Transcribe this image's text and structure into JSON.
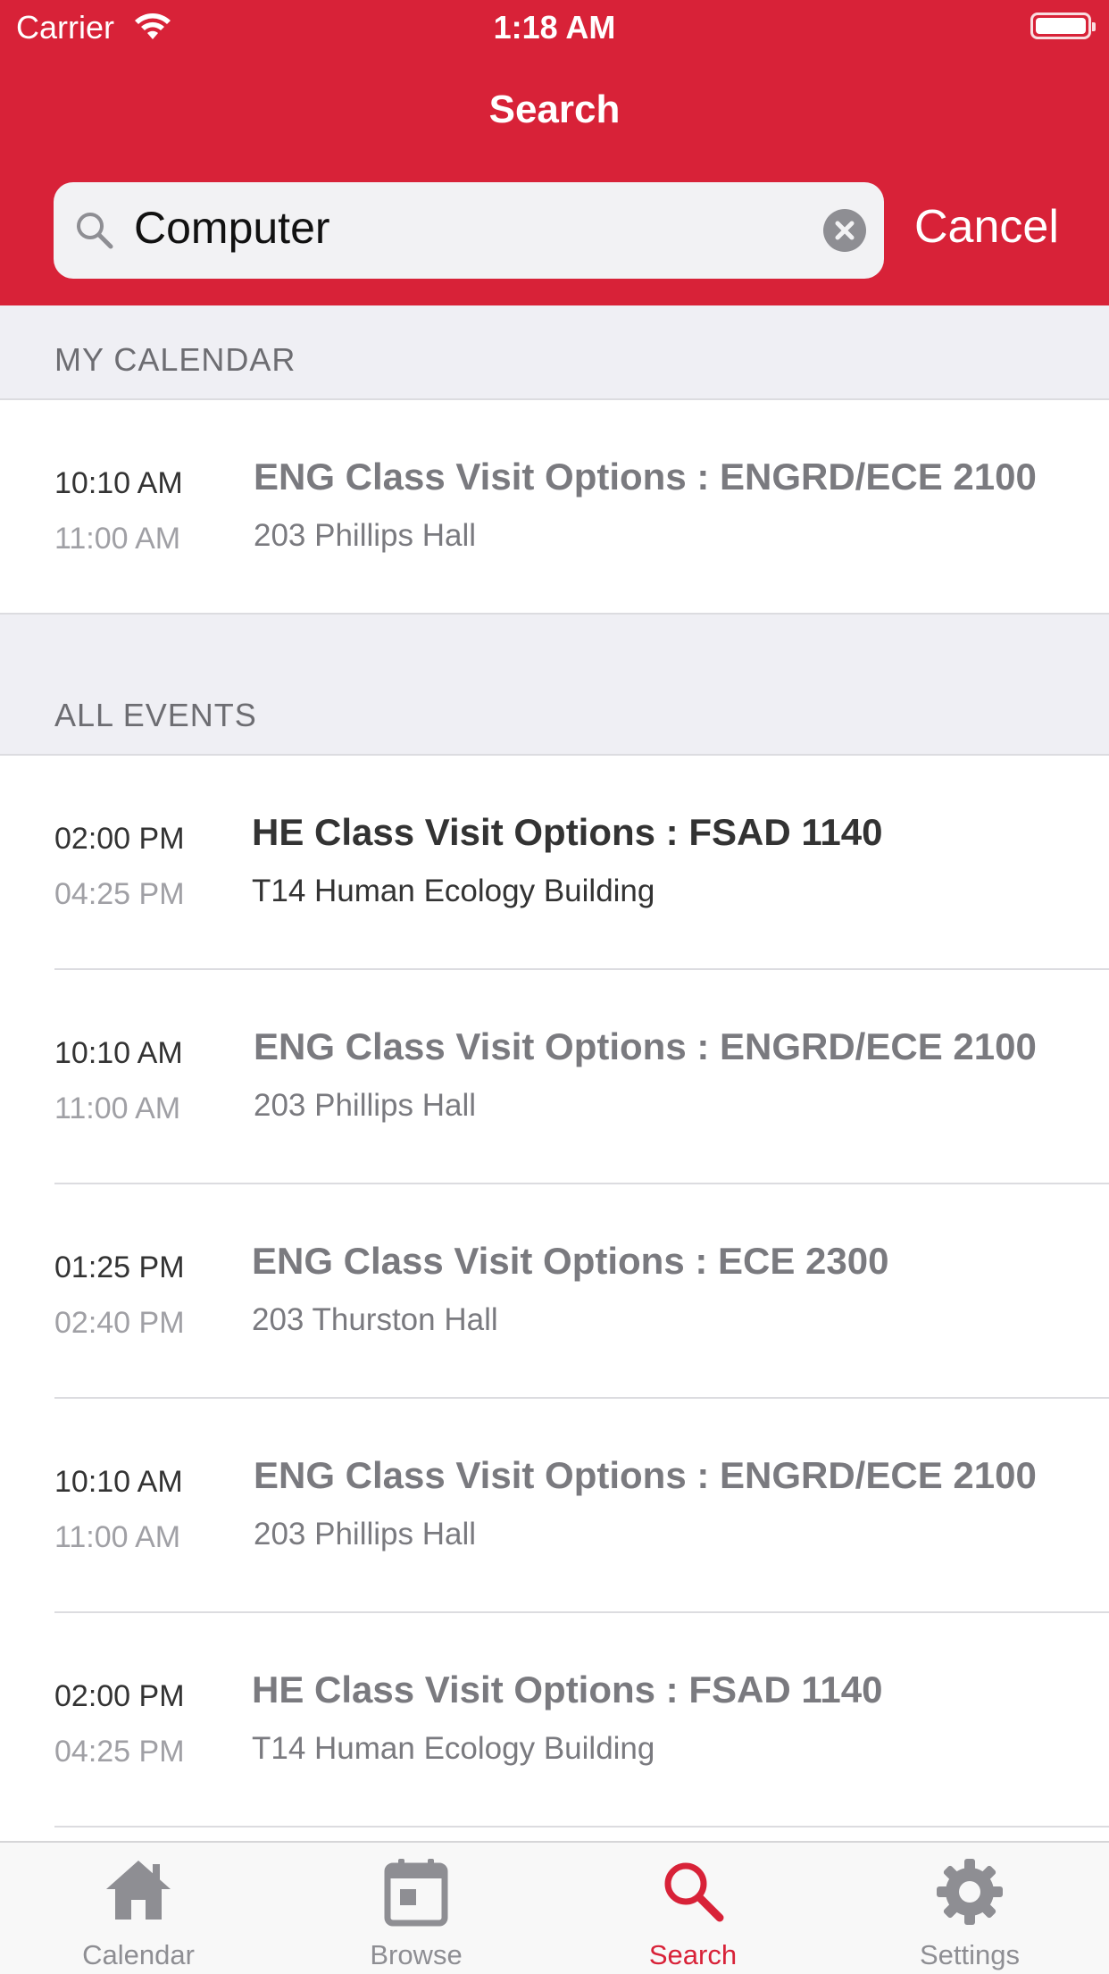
{
  "status_bar": {
    "carrier": "Carrier",
    "time": "1:18 AM"
  },
  "nav": {
    "title": "Search"
  },
  "search": {
    "value": "Computer",
    "cancel_label": "Cancel"
  },
  "sections": {
    "my_calendar": {
      "header": "MY CALENDAR",
      "events": [
        {
          "start": "10:10 AM",
          "end": "11:00 AM",
          "title": "ENG Class Visit Options : ENGRD/ECE 2100",
          "location": "203 Phillips Hall"
        }
      ]
    },
    "all_events": {
      "header": "ALL EVENTS",
      "events": [
        {
          "start": "02:00 PM",
          "end": "04:25 PM",
          "title": "HE Class Visit Options : FSAD 1140",
          "location": "T14 Human Ecology Building"
        },
        {
          "start": "10:10 AM",
          "end": "11:00 AM",
          "title": "ENG Class Visit Options : ENGRD/ECE 2100",
          "location": "203 Phillips Hall"
        },
        {
          "start": "01:25 PM",
          "end": "02:40 PM",
          "title": "ENG Class Visit Options : ECE 2300",
          "location": "203 Thurston Hall"
        },
        {
          "start": "10:10 AM",
          "end": "11:00 AM",
          "title": "ENG Class Visit Options : ENGRD/ECE 2100",
          "location": "203 Phillips Hall"
        },
        {
          "start": "02:00 PM",
          "end": "04:25 PM",
          "title": "HE Class Visit Options : FSAD 1140",
          "location": "T14 Human Ecology Building"
        }
      ]
    }
  },
  "tabbar": {
    "items": [
      {
        "label": "Calendar",
        "icon": "home-icon"
      },
      {
        "label": "Browse",
        "icon": "calendar-icon"
      },
      {
        "label": "Search",
        "icon": "search-icon",
        "active": true
      },
      {
        "label": "Settings",
        "icon": "gear-icon"
      }
    ]
  },
  "colors": {
    "brand": "#d82238",
    "section_bg": "#efeff4",
    "muted": "#8e8e93"
  }
}
